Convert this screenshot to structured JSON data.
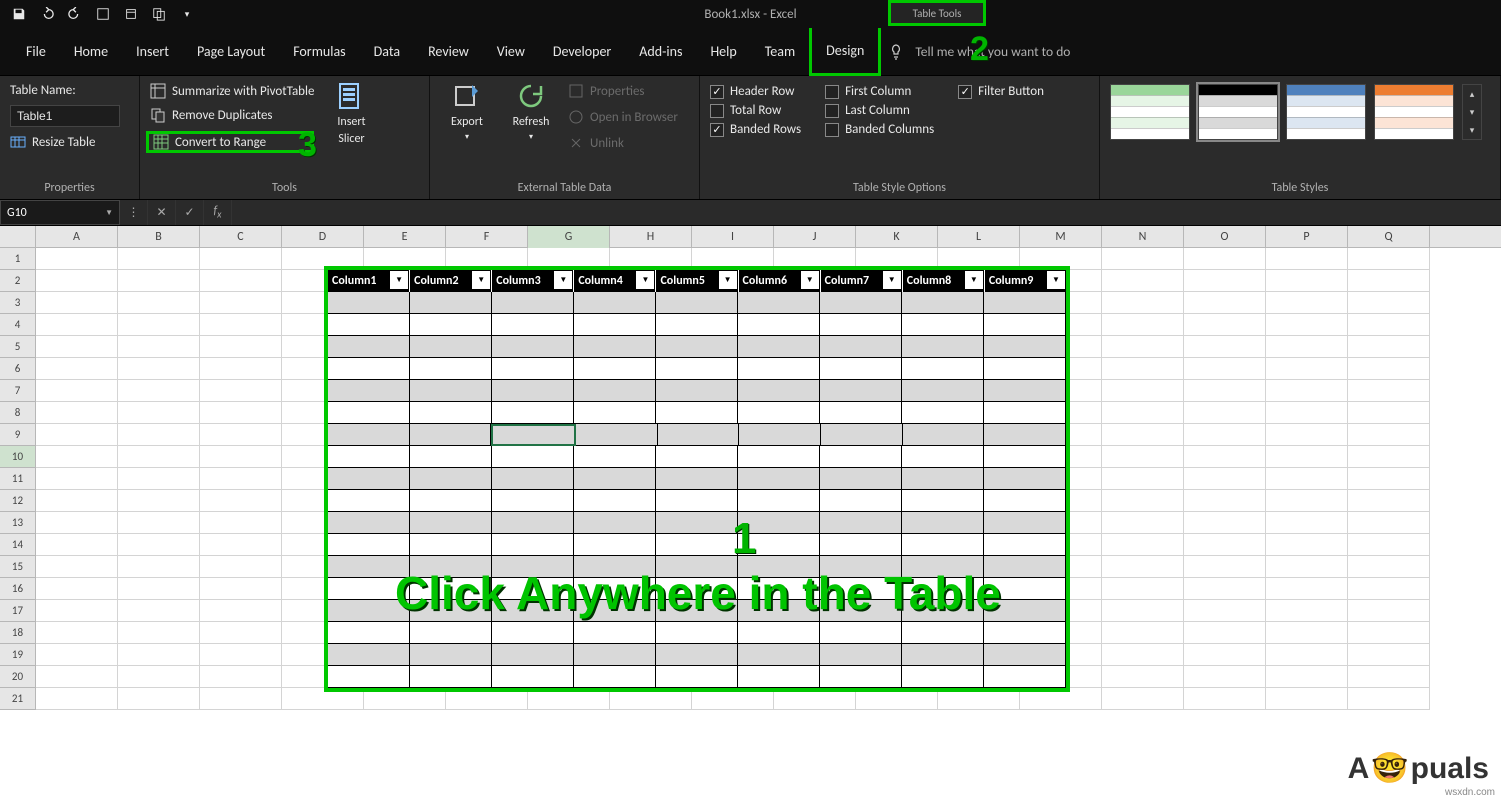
{
  "title": "Book1.xlsx  -  Excel",
  "table_tools_label": "Table Tools",
  "tabs": [
    "File",
    "Home",
    "Insert",
    "Page Layout",
    "Formulas",
    "Data",
    "Review",
    "View",
    "Developer",
    "Add-ins",
    "Help",
    "Team",
    "Design"
  ],
  "tellme": "Tell me what you want to do",
  "properties": {
    "table_name_label": "Table Name:",
    "table_name_value": "Table1",
    "resize": "Resize Table",
    "group": "Properties"
  },
  "tools": {
    "pivot": "Summarize with PivotTable",
    "dup": "Remove Duplicates",
    "convert": "Convert to Range",
    "slicer_top": "Insert",
    "slicer_bot": "Slicer",
    "group": "Tools"
  },
  "ext": {
    "export": "Export",
    "refresh": "Refresh",
    "props": "Properties",
    "browser": "Open in Browser",
    "unlink": "Unlink",
    "group": "External Table Data"
  },
  "styleopts": {
    "header": "Header Row",
    "total": "Total Row",
    "banded_rows": "Banded Rows",
    "first": "First Column",
    "last": "Last Column",
    "banded_cols": "Banded Columns",
    "filter": "Filter Button",
    "group": "Table Style Options"
  },
  "styles_group": "Table Styles",
  "namebox": "G10",
  "columns_letters": [
    "A",
    "B",
    "C",
    "D",
    "E",
    "F",
    "G",
    "H",
    "I",
    "J",
    "K",
    "L",
    "M",
    "N",
    "O",
    "P",
    "Q"
  ],
  "rows": [
    1,
    2,
    3,
    4,
    5,
    6,
    7,
    8,
    9,
    10,
    11,
    12,
    13,
    14,
    15,
    16,
    17,
    18,
    19,
    20,
    21
  ],
  "table_headers": [
    "Column1",
    "Column2",
    "Column3",
    "Column4",
    "Column5",
    "Column6",
    "Column7",
    "Column8",
    "Column9"
  ],
  "annotation": {
    "n1": "1",
    "n2": "2",
    "n3": "3",
    "text": "Click Anywhere in the Table"
  },
  "watermark": "wsxdn.com",
  "brand_left": "A",
  "brand_right": "puals"
}
